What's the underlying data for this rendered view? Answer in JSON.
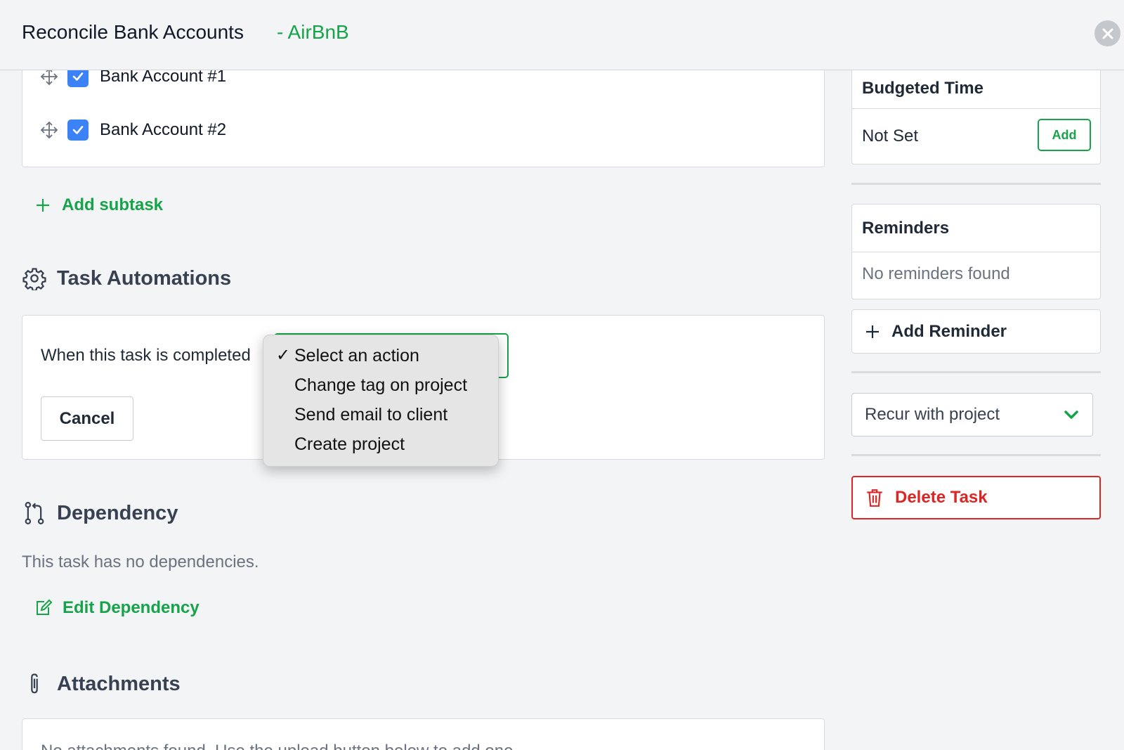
{
  "header": {
    "title": "Reconcile Bank Accounts",
    "client": "- AirBnB"
  },
  "subtasks": [
    {
      "label": "Bank Account #1",
      "checked": true
    },
    {
      "label": "Bank Account #2",
      "checked": true
    }
  ],
  "add_subtask_label": "Add subtask",
  "automations": {
    "title": "Task Automations",
    "prompt": "When this task is completed",
    "cancel_label": "Cancel",
    "options": [
      "Select an action",
      "Change tag on project",
      "Send email to client",
      "Create project"
    ],
    "selected": "Select an action"
  },
  "dependency": {
    "title": "Dependency",
    "empty_text": "This task has no dependencies.",
    "edit_label": "Edit Dependency"
  },
  "attachments": {
    "title": "Attachments",
    "empty_text": "No attachments found. Use the upload button below to add one."
  },
  "sidebar": {
    "budgeted_time": {
      "title": "Budgeted Time",
      "value": "Not Set",
      "add_label": "Add"
    },
    "reminders": {
      "title": "Reminders",
      "empty_text": "No reminders found",
      "add_label": "Add Reminder"
    },
    "recur_select": "Recur with project",
    "delete_label": "Delete Task"
  },
  "colors": {
    "accent_green": "#16a34a",
    "danger_red": "#dc2626",
    "checkbox_blue": "#3b82f6"
  }
}
